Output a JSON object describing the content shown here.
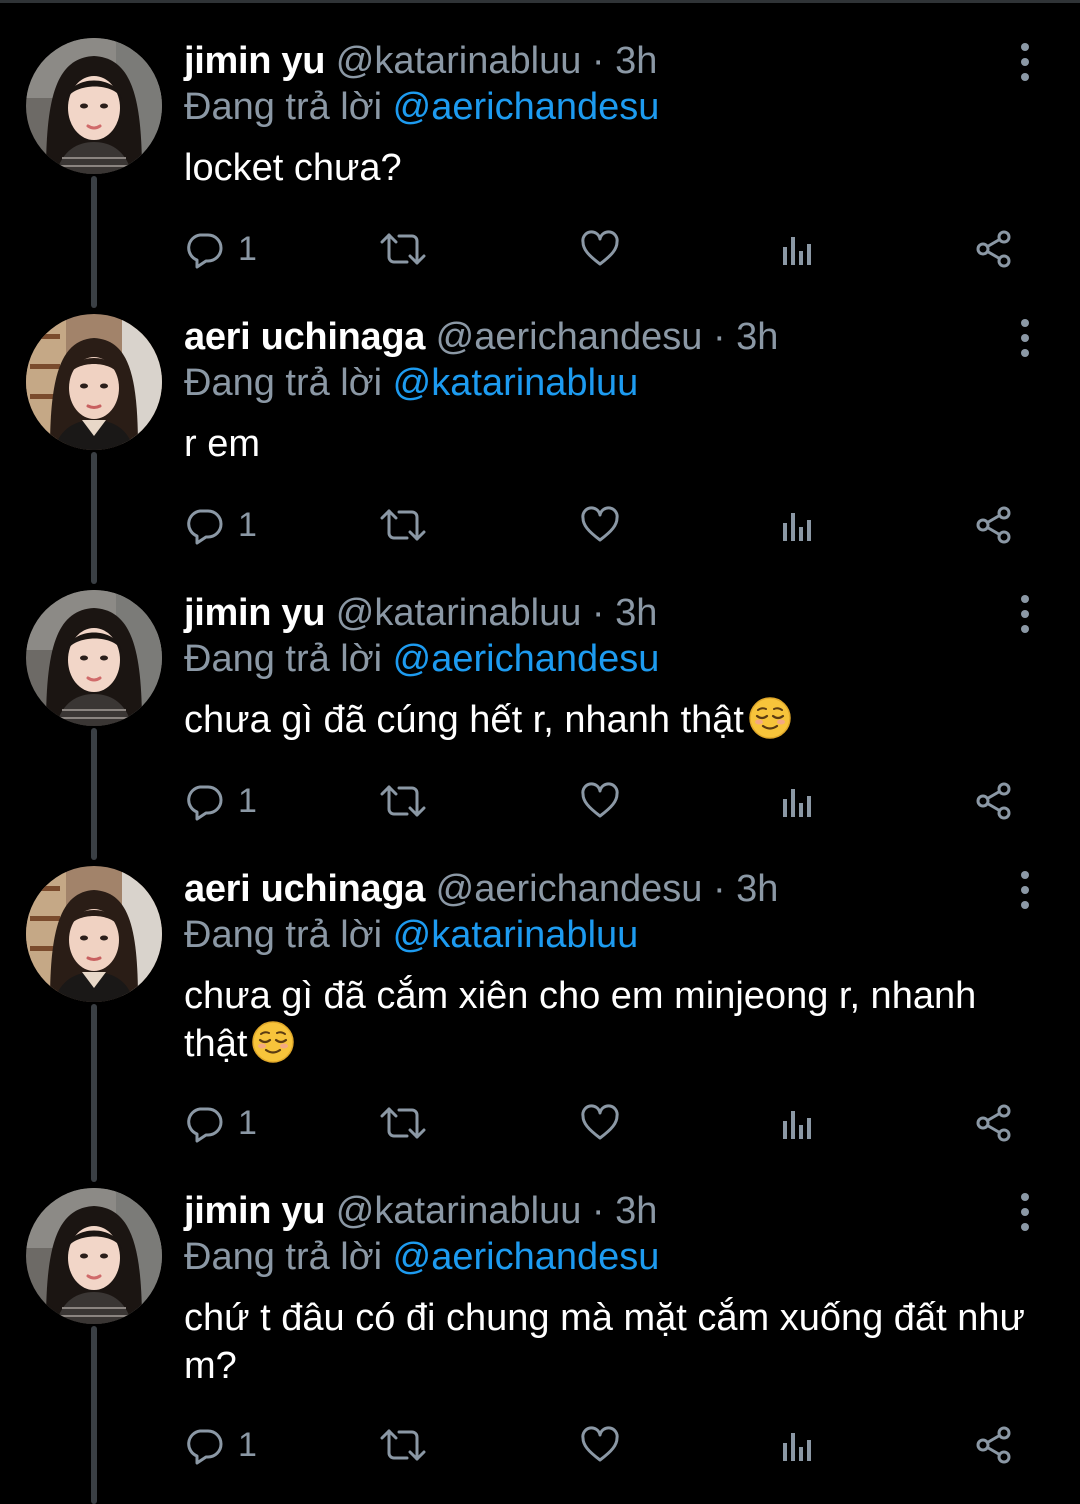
{
  "colors": {
    "background": "#000000",
    "name": "#ffffff",
    "secondary": "#8b98a5",
    "mention": "#1d9bf0",
    "thread_line": "#3a3f44"
  },
  "tweets": [
    {
      "name": "jimin yu",
      "handle": "@katarinabluu",
      "dot": "·",
      "time": "3h",
      "replying_prefix": "Đang trả lời",
      "replying_to": "@aerichandesu",
      "text": "locket chưa?",
      "reply_count": "1",
      "avatar": "jimin-avatar"
    },
    {
      "name": "aeri uchinaga",
      "handle": "@aerichandesu",
      "dot": "·",
      "time": "3h",
      "replying_prefix": "Đang trả lời",
      "replying_to": "@katarinabluu",
      "text": "r em",
      "reply_count": "1",
      "avatar": "aeri-avatar"
    },
    {
      "name": "jimin yu",
      "handle": "@katarinabluu",
      "dot": "·",
      "time": "3h",
      "replying_prefix": "Đang trả lời",
      "replying_to": "@aerichandesu",
      "text": "chưa gì đã cúng hết r, nhanh thật",
      "emoji": "relieved-face",
      "reply_count": "1",
      "avatar": "jimin-avatar"
    },
    {
      "name": "aeri uchinaga",
      "handle": "@aerichandesu",
      "dot": "·",
      "time": "3h",
      "replying_prefix": "Đang trả lời",
      "replying_to": "@katarinabluu",
      "text": "chưa gì đã cắm xiên cho em minjeong r, nhanh thật",
      "emoji": "relieved-face",
      "reply_count": "1",
      "avatar": "aeri-avatar"
    },
    {
      "name": "jimin yu",
      "handle": "@katarinabluu",
      "dot": "·",
      "time": "3h",
      "replying_prefix": "Đang trả lời",
      "replying_to": "@aerichandesu",
      "text": "chứ t đâu có đi chung mà mặt cắm xuống đất như m?",
      "reply_count": "1",
      "avatar": "jimin-avatar"
    }
  ]
}
